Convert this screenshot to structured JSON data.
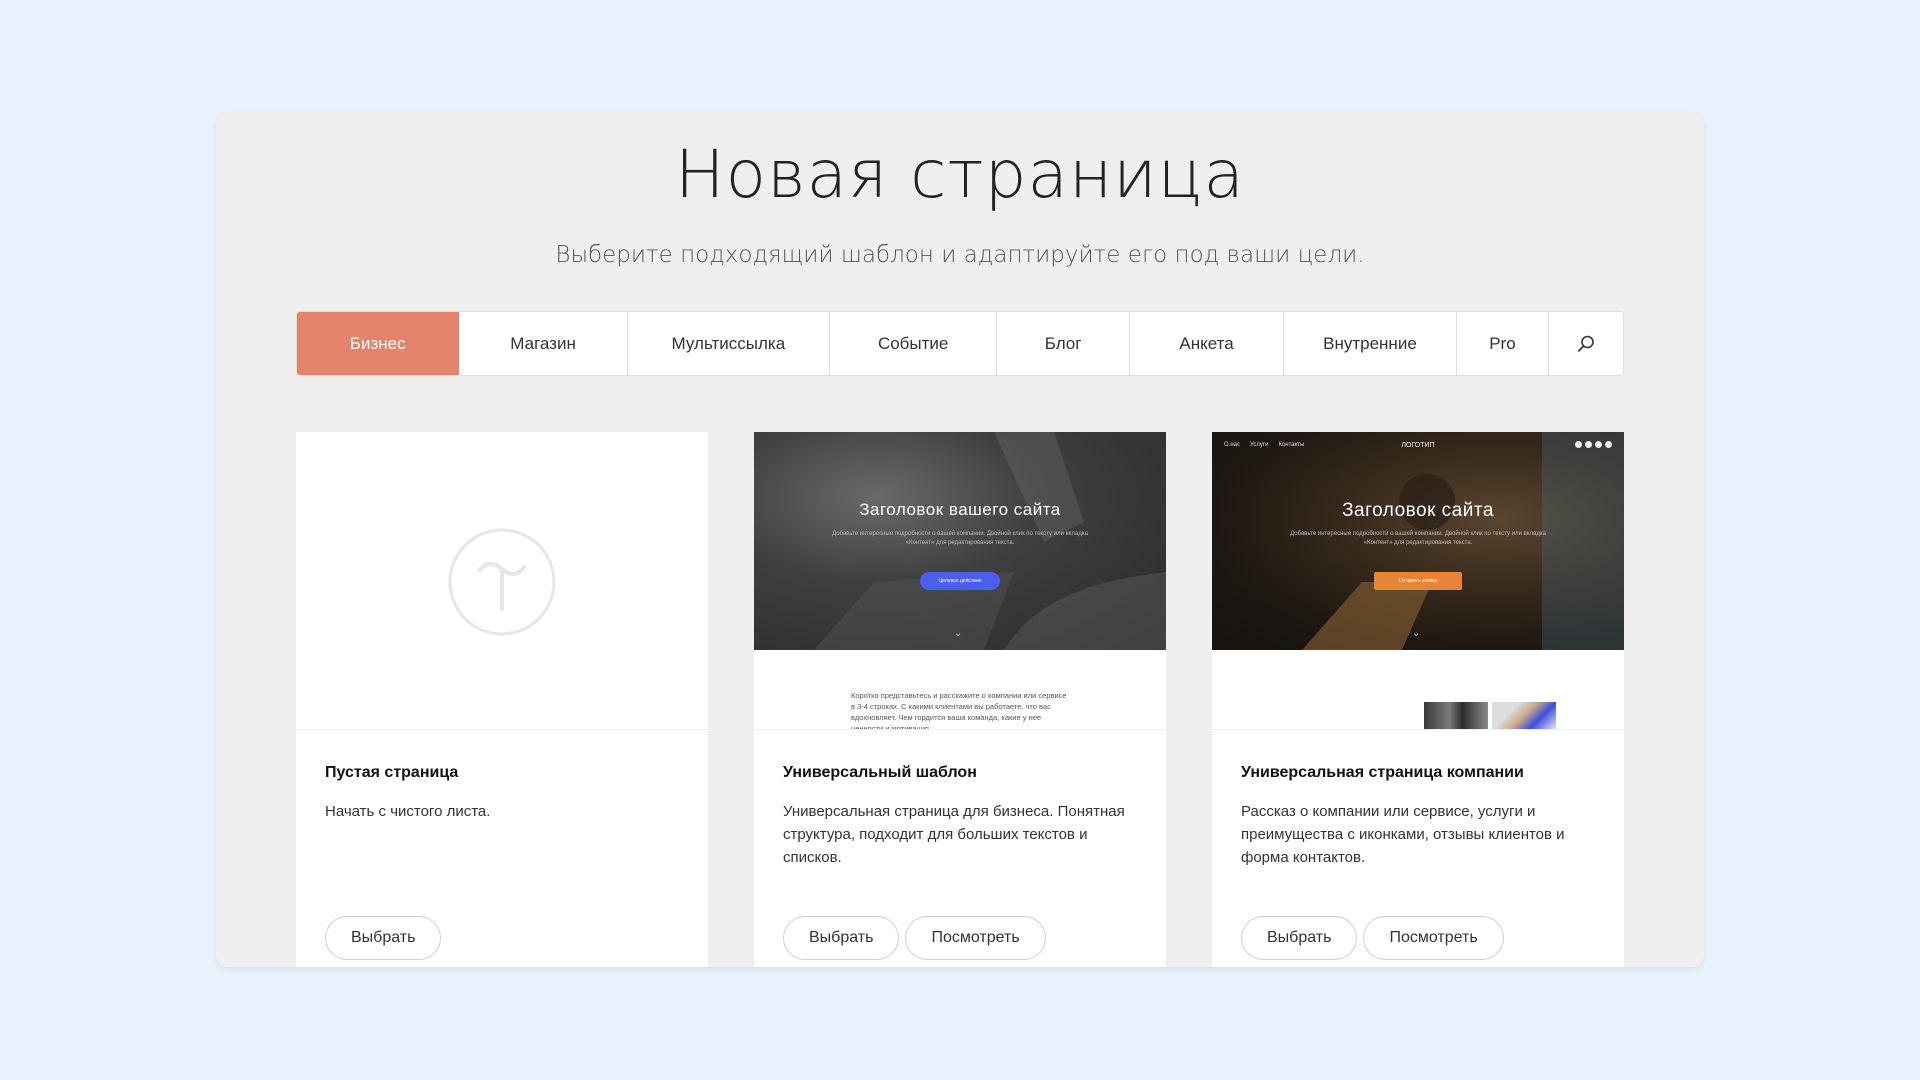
{
  "header": {
    "title": "Новая страница",
    "subtitle": "Выберите подходящий шаблон и адаптируйте его под ваши цели."
  },
  "tabs": [
    {
      "label": "Бизнес",
      "active": true
    },
    {
      "label": "Магазин"
    },
    {
      "label": "Мультиссылка"
    },
    {
      "label": "Событие"
    },
    {
      "label": "Блог"
    },
    {
      "label": "Анкета"
    },
    {
      "label": "Внутренние"
    },
    {
      "label": "Pro"
    }
  ],
  "search_icon": "search-icon",
  "accent_color": "#e3836c",
  "cards": [
    {
      "title": "Пустая страница",
      "description": "Начать с чистого листа.",
      "select_label": "Выбрать"
    },
    {
      "title": "Универсальный шаблон",
      "description": "Универсальная страница для бизнеса. Понятная структура, подходит для больших текстов и списков.",
      "select_label": "Выбрать",
      "view_label": "Посмотреть",
      "preview": {
        "heading": "Заголовок вашего сайта",
        "sub": "Добавьте интересные подробности о вашей компании. Двойной клик по тексту или вкладка «Контент» для редактирования текста.",
        "button": "Целевое действие",
        "text": "Коротко представьтесь и расскажите о компании или сервисе в 3-4 строках. С какими клиентами вы работаете, что вас вдохновляет. Чем гордится ваша команда, какие у нее ценности и мотивация."
      }
    },
    {
      "title": "Универсальная страница компании",
      "description": "Рассказ о компании или сервисе, услуги и преимущества с иконками, отзывы клиентов и форма контактов.",
      "select_label": "Выбрать",
      "view_label": "Посмотреть",
      "preview": {
        "nav": [
          "О нас",
          "Услуги",
          "Контакты"
        ],
        "logo": "ЛОГОТИП",
        "heading": "Заголовок сайта",
        "sub": "Добавьте интересные подробности о вашей компании. Двойной клик по тексту или вкладка «Контент» для редактирования текста.",
        "button": "Оставить заявку"
      }
    }
  ]
}
